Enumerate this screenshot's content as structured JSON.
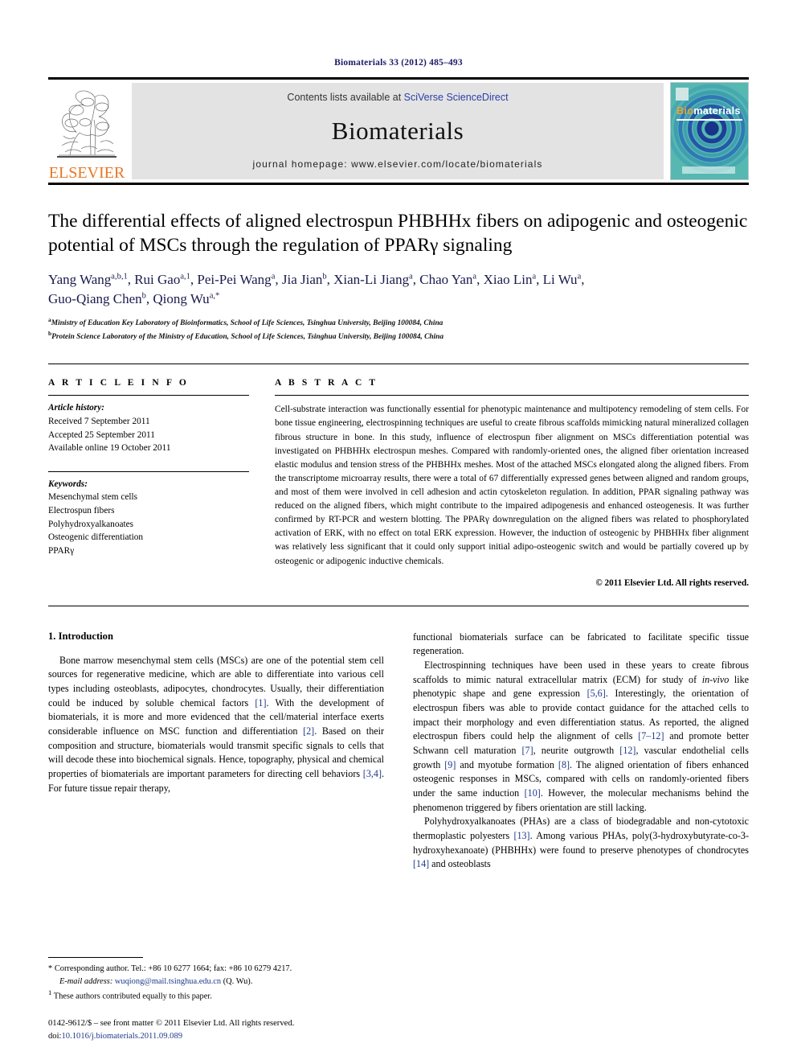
{
  "running_head": "Biomaterials 33 (2012) 485–493",
  "masthead": {
    "contents_prefix": "Contents lists available at ",
    "contents_link": "SciVerse ScienceDirect",
    "journal_name": "Biomaterials",
    "homepage": "journal homepage: www.elsevier.com/locate/biomaterials",
    "publisher_logo_text": "ELSEVIER",
    "cover_title_part1": "Bio",
    "cover_title_part2": "materials",
    "accent_orange": "#E87722",
    "link_blue": "#2b3fa8",
    "cover_teal": "#4fb3ae",
    "cover_blue": "#1f3f9e"
  },
  "article": {
    "title": "The differential effects of aligned electrospun PHBHHx fibers on adipogenic and osteogenic potential of MSCs through the regulation of PPARγ signaling",
    "authors_line1": "Yang Wang a,b,1, Rui Gao a,1, Pei-Pei Wang a, Jia Jian b, Xian-Li Jiang a, Chao Yan a, Xiao Lin a, Li Wu a,",
    "authors_line2": "Guo-Qiang Chen b, Qiong Wu a,*",
    "affiliation_a": "Ministry of Education Key Laboratory of Bioinformatics, School of Life Sciences, Tsinghua University, Beijing 100084, China",
    "affiliation_b": "Protein Science Laboratory of the Ministry of Education, School of Life Sciences, Tsinghua University, Beijing 100084, China"
  },
  "article_info": {
    "heading": "A R T I C L E   I N F O",
    "history_label": "Article history:",
    "history": [
      "Received 7 September 2011",
      "Accepted 25 September 2011",
      "Available online 19 October 2011"
    ],
    "keywords_label": "Keywords:",
    "keywords": [
      "Mesenchymal stem cells",
      "Electrospun fibers",
      "Polyhydroxyalkanoates",
      "Osteogenic differentiation",
      "PPARγ"
    ]
  },
  "abstract": {
    "heading": "A B S T R A C T",
    "text": "Cell-substrate interaction was functionally essential for phenotypic maintenance and multipotency remodeling of stem cells. For bone tissue engineering, electrospinning techniques are useful to create fibrous scaffolds mimicking natural mineralized collagen fibrous structure in bone. In this study, influence of electrospun fiber alignment on MSCs differentiation potential was investigated on PHBHHx electrospun meshes. Compared with randomly-oriented ones, the aligned fiber orientation increased elastic modulus and tension stress of the PHBHHx meshes. Most of the attached MSCs elongated along the aligned fibers. From the transcriptome microarray results, there were a total of 67 differentially expressed genes between aligned and random groups, and most of them were involved in cell adhesion and actin cytoskeleton regulation. In addition, PPAR signaling pathway was reduced on the aligned fibers, which might contribute to the impaired adipogenesis and enhanced osteogenesis. It was further confirmed by RT-PCR and western blotting. The PPARγ downregulation on the aligned fibers was related to phosphorylated activation of ERK, with no effect on total ERK expression. However, the induction of osteogenic by PHBHHx fiber alignment was relatively less significant that it could only support initial adipo-osteogenic switch and would be partially covered up by osteogenic or adipogenic inductive chemicals.",
    "copyright": "© 2011 Elsevier Ltd. All rights reserved."
  },
  "introduction": {
    "heading": "1.  Introduction",
    "left_p1_a": "Bone marrow mesenchymal stem cells (MSCs) are one of the potential stem cell sources for regenerative medicine, which are able to differentiate into various cell types including osteoblasts, adipocytes, chondrocytes. Usually, their differentiation could be induced by soluble chemical factors ",
    "left_p1_ref1": "[1]",
    "left_p1_b": ". With the development of biomaterials, it is more and more evidenced that the cell/material interface exerts considerable influence on MSC function and differentiation ",
    "left_p1_ref2": "[2]",
    "left_p1_c": ". Based on their composition and structure, biomaterials would transmit specific signals to cells that will decode these into biochemical signals. Hence, topography, physical and chemical properties of biomaterials are important parameters for directing cell behaviors ",
    "left_p1_ref3": "[3,4]",
    "left_p1_d": ". For future tissue repair therapy,",
    "right_p1": "functional biomaterials surface can be fabricated to facilitate specific tissue regeneration.",
    "right_p2_a": "Electrospinning techniques have been used in these years to create fibrous scaffolds to mimic natural extracellular matrix (ECM) for study of ",
    "right_p2_ital": "in-vivo",
    "right_p2_b": " like phenotypic shape and gene expression ",
    "right_p2_ref1": "[5,6]",
    "right_p2_c": ". Interestingly, the orientation of electrospun fibers was able to provide contact guidance for the attached cells to impact their morphology and even differentiation status. As reported, the aligned electrospun fibers could help the alignment of cells ",
    "right_p2_ref2": "[7–12]",
    "right_p2_d": " and promote better Schwann cell maturation ",
    "right_p2_ref3": "[7]",
    "right_p2_e": ", neurite outgrowth ",
    "right_p2_ref4": "[12]",
    "right_p2_f": ", vascular endothelial cells growth ",
    "right_p2_ref5": "[9]",
    "right_p2_g": " and myotube formation ",
    "right_p2_ref6": "[8]",
    "right_p2_h": ". The aligned orientation of fibers enhanced osteogenic responses in MSCs, compared with cells on randomly-oriented fibers under the same induction ",
    "right_p2_ref7": "[10]",
    "right_p2_i": ". However, the molecular mechanisms behind the phenomenon triggered by fibers orientation are still lacking.",
    "right_p3_a": "Polyhydroxyalkanoates (PHAs) are a class of biodegradable and non-cytotoxic thermoplastic polyesters ",
    "right_p3_ref1": "[13]",
    "right_p3_b": ". Among various PHAs, poly(3-hydroxybutyrate-co-3-hydroxyhexanoate) (PHBHHx) were found to preserve phenotypes of chondrocytes ",
    "right_p3_ref2": "[14]",
    "right_p3_c": " and osteoblasts"
  },
  "footnotes": {
    "corresponding_mark": "*",
    "corresponding_text": "Corresponding author. Tel.: +86 10 6277 1664; fax: +86 10 6279 4217.",
    "email_label": "E-mail address:",
    "email": "wuqiong@mail.tsinghua.edu.cn",
    "email_suffix": "(Q. Wu).",
    "equal_mark": "1",
    "equal_text": "These authors contributed equally to this paper."
  },
  "imprint": {
    "issn_line": "0142-9612/$ – see front matter © 2011 Elsevier Ltd. All rights reserved.",
    "doi_label": "doi:",
    "doi_value": "10.1016/j.biomaterials.2011.09.089"
  }
}
